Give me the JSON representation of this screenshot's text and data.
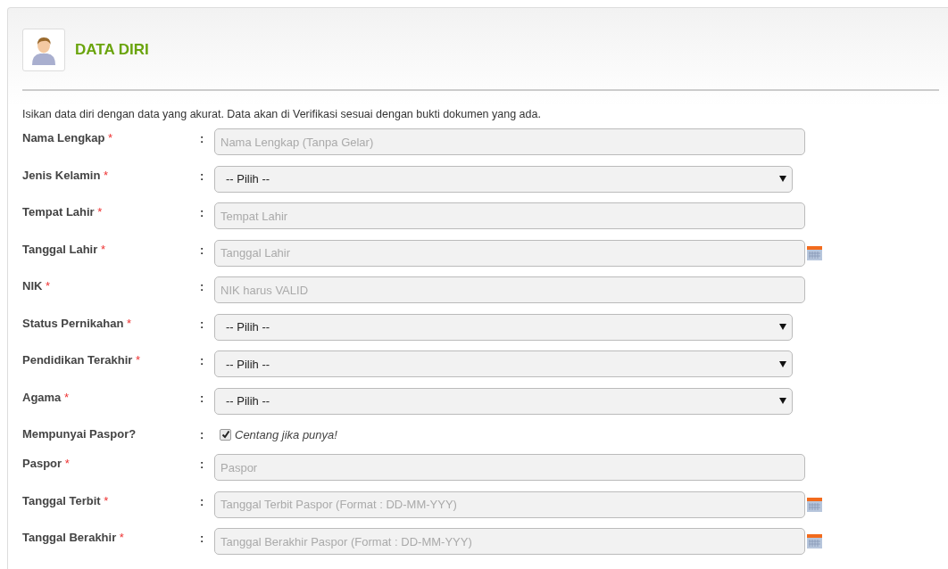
{
  "panel": {
    "title": "DATA DIRI",
    "intro": "Isikan data diri dengan data yang akurat. Data akan di Verifikasi sesuai dengan bukti dokumen yang ada."
  },
  "fields": [
    {
      "kind": "text",
      "label": "Nama Lengkap",
      "required": true,
      "placeholder": "Nama Lengkap (Tanpa Gelar)"
    },
    {
      "kind": "select",
      "label": "Jenis Kelamin",
      "required": true,
      "value": "-- Pilih --"
    },
    {
      "kind": "text",
      "label": "Tempat Lahir",
      "required": true,
      "placeholder": "Tempat Lahir"
    },
    {
      "kind": "date",
      "label": "Tanggal Lahir",
      "required": true,
      "placeholder": "Tanggal Lahir"
    },
    {
      "kind": "text",
      "label": "NIK",
      "required": true,
      "placeholder": "NIK harus VALID"
    },
    {
      "kind": "select",
      "label": "Status Pernikahan",
      "required": true,
      "value": "-- Pilih --"
    },
    {
      "kind": "select",
      "label": "Pendidikan Terakhir",
      "required": true,
      "value": "-- Pilih --"
    },
    {
      "kind": "select",
      "label": "Agama",
      "required": true,
      "value": "-- Pilih --"
    },
    {
      "kind": "checkbox",
      "label": "Mempunyai Paspor?",
      "required": false,
      "checked": true,
      "text": "Centang jika punya!"
    },
    {
      "kind": "text",
      "label": "Paspor",
      "required": true,
      "placeholder": "Paspor"
    },
    {
      "kind": "date",
      "label": "Tanggal Terbit",
      "required": true,
      "placeholder": "Tanggal Terbit Paspor (Format : DD-MM-YYY)"
    },
    {
      "kind": "date",
      "label": "Tanggal Berakhir",
      "required": true,
      "placeholder": "Tanggal Berakhir Paspor (Format : DD-MM-YYY)"
    }
  ],
  "colon": ":",
  "required_mark": "*"
}
